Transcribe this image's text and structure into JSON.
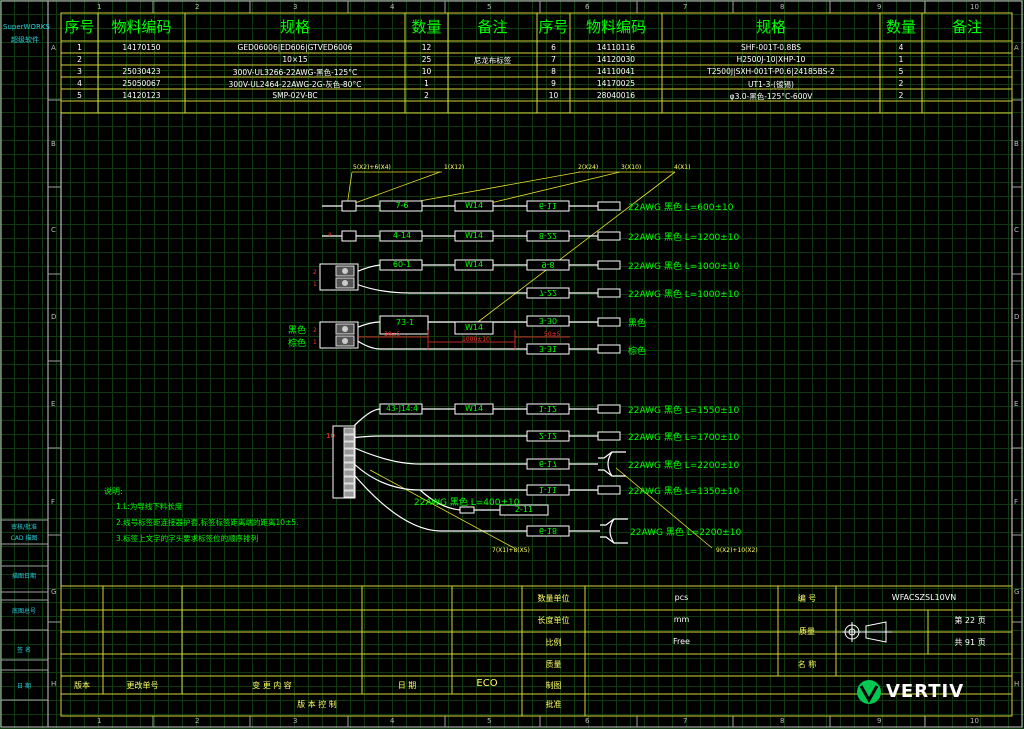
{
  "app": {
    "logo_text": "SuperWORKS",
    "logo_sub": "超级软件"
  },
  "left_panel": {
    "items": [
      "审核/批准",
      "CAD 描图",
      "描图日期",
      "底图总号",
      "签 名",
      "日 期"
    ]
  },
  "col_numbers": [
    "1",
    "2",
    "3",
    "4",
    "5",
    "6",
    "7",
    "8",
    "9",
    "10"
  ],
  "row_letters": [
    "A",
    "B",
    "C",
    "D",
    "E",
    "F",
    "G",
    "H"
  ],
  "bom": {
    "headers": [
      "序号",
      "物料编码",
      "规格",
      "数量",
      "备注"
    ],
    "left_rows": [
      {
        "no": "1",
        "code": "14170150",
        "spec": "GED06006|ED606|GTVED6006",
        "qty": "12",
        "note": ""
      },
      {
        "no": "2",
        "code": "",
        "spec": "10×15",
        "qty": "25",
        "note": "尼龙布标签"
      },
      {
        "no": "3",
        "code": "25030423",
        "spec": "300V-UL3266-22AWG-黑色-125°C",
        "qty": "10",
        "note": ""
      },
      {
        "no": "4",
        "code": "25050067",
        "spec": "300V-UL2464-22AWG-2G-灰色-80°C",
        "qty": "1",
        "note": ""
      },
      {
        "no": "5",
        "code": "14120123",
        "spec": "SMP-02V-BC",
        "qty": "2",
        "note": ""
      }
    ],
    "right_rows": [
      {
        "no": "6",
        "code": "14110116",
        "spec": "SHF-001T-0.8BS",
        "qty": "4",
        "note": ""
      },
      {
        "no": "7",
        "code": "14120030",
        "spec": "H2500J-10|XHP-10",
        "qty": "1",
        "note": ""
      },
      {
        "no": "8",
        "code": "14110041",
        "spec": "T2500J|SXH-001T-P0.6|24185BS-2",
        "qty": "5",
        "note": ""
      },
      {
        "no": "9",
        "code": "14170025",
        "spec": "UT1-3-(镀锡)",
        "qty": "2",
        "note": ""
      },
      {
        "no": "10",
        "code": "28040016",
        "spec": "φ3.0-黑色-125°C-600V",
        "qty": "2",
        "note": ""
      }
    ]
  },
  "drawing": {
    "callouts": [
      "5(X2)+6(X4)",
      "1(X12)",
      "2(X24)",
      "3(X10)",
      "4(X1)",
      "7(X1)+8(X5)",
      "9(X2)+10(X2)"
    ],
    "group1": [
      {
        "wire_label": "7-6",
        "tag": "W14",
        "end_label": "6-11",
        "spec": "22AWG 黑色 L=600±10"
      },
      {
        "wire_label": "4-14",
        "tag": "W14",
        "end_label": "8-22",
        "spec": "22AWG 黑色 L=1200±10"
      },
      {
        "wire_label": "60-1",
        "tag": "W14",
        "end_label": "9-8",
        "spec": "22AWG 黑色 L=1000±10"
      },
      {
        "wire_label": "",
        "tag": "",
        "end_label": "7-22",
        "spec": "22AWG 黑色 L=1000±10"
      }
    ],
    "group2": {
      "left_labels": [
        "黑色",
        "棕色"
      ],
      "wire_label": "73-1",
      "tag": "W14",
      "end_top": "3-30",
      "end_bottom": "3-31",
      "right_labels": [
        "黑色",
        "棕色"
      ],
      "dim_left": "30±5",
      "dim_mid": "1000±10",
      "dim_right": "50±5"
    },
    "group3": [
      {
        "wire_label": "43-J14:4",
        "tag": "W14",
        "end_label": "1-12",
        "spec": "22AWG 黑色 L=1550±10"
      },
      {
        "wire_label": "",
        "tag": "",
        "end_label": "2-12",
        "spec": "22AWG 黑色 L=1700±10"
      },
      {
        "wire_label": "",
        "tag": "",
        "end_label": "6-17",
        "spec": "22AWG 黑色 L=2200±10"
      },
      {
        "wire_label": "",
        "tag": "",
        "end_label": "1-11",
        "spec": "22AWG 黑色 L=1350±10"
      },
      {
        "wire_label": "",
        "tag": "",
        "end_label": "6-18",
        "spec": "22AWG 黑色 L=2200±10"
      }
    ],
    "branch": {
      "spec": "22AWG 黑色 L=400±10",
      "label": "2-11"
    },
    "notes": {
      "title": "说明:",
      "lines": [
        "1.L:为导线下料长度",
        "2.线号标签距连接器护套,标签标签距离端的距离10±5.",
        "3.标签上文字的字头要求标签位的顺序排列"
      ]
    }
  },
  "titleblock": {
    "unit_label": "数量单位",
    "unit_value": "pcs",
    "length_label": "长度单位",
    "length_value": "mm",
    "scale_label": "比例",
    "scale_value": "Free",
    "mass_label": "质量",
    "doc_label": "编 号",
    "doc_value": "WFACSZSL10VN",
    "sheet_label": "第 22 页",
    "total_label": "共 91 页",
    "name_label": "名 称",
    "ver_label": "版本",
    "ecn_label": "更改单号",
    "change_label": "变 更 内 容",
    "date_label": "日 期",
    "eco_label": "ECO",
    "draw_label": "制图",
    "approve_label": "批准",
    "ver_ctrl_label": "版 本 控 制",
    "brand": "VERTIV"
  }
}
